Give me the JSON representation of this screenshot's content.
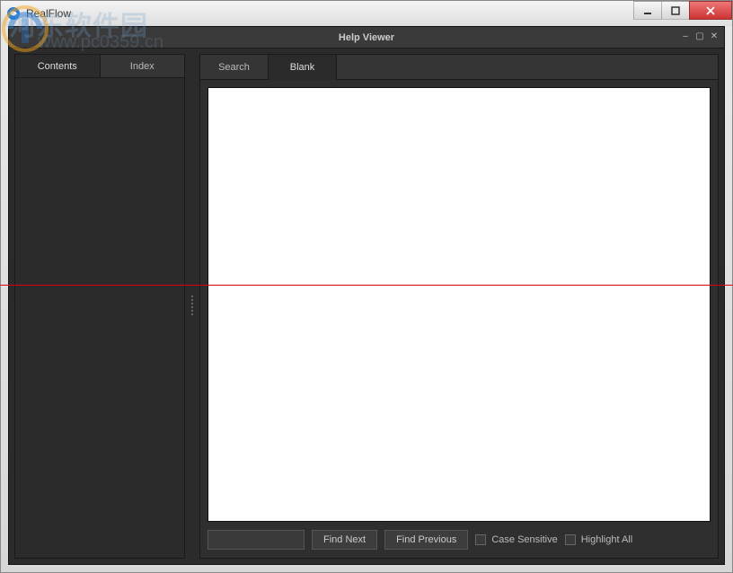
{
  "outer_window": {
    "title": "RealFlow"
  },
  "inner_window": {
    "title": "Help Viewer"
  },
  "left_panel": {
    "tabs": [
      {
        "label": "Contents",
        "active": true
      },
      {
        "label": "Index",
        "active": false
      }
    ]
  },
  "right_panel": {
    "tabs": [
      {
        "label": "Search",
        "active": false
      },
      {
        "label": "Blank",
        "active": true
      }
    ]
  },
  "find_bar": {
    "input_value": "",
    "find_next": "Find Next",
    "find_previous": "Find Previous",
    "case_sensitive": "Case Sensitive",
    "highlight_all": "Highlight All"
  },
  "watermark": {
    "line1": "河东软件园",
    "line2": "www.pc0359.cn"
  }
}
